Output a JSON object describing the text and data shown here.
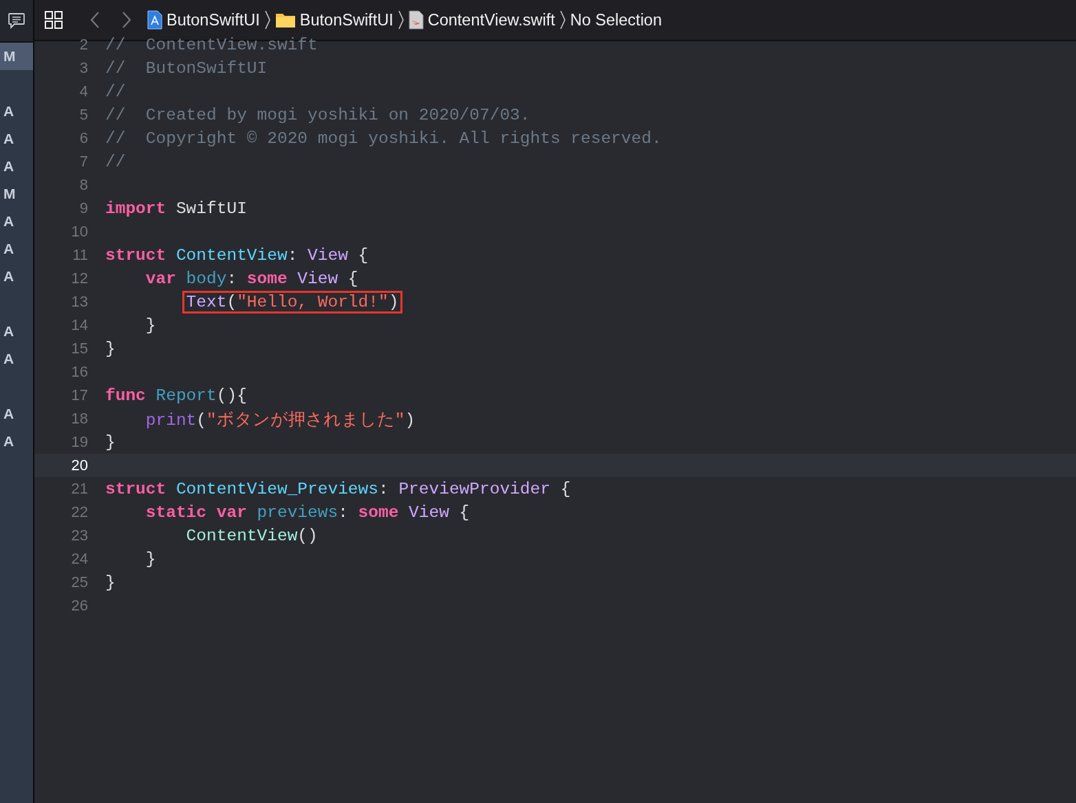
{
  "toolbar": {
    "breadcrumb": [
      {
        "kind": "project",
        "label": "ButonSwiftUI"
      },
      {
        "kind": "folder",
        "label": "ButonSwiftUI"
      },
      {
        "kind": "swift",
        "label": "ContentView.swift"
      },
      {
        "kind": "plain",
        "label": "No Selection"
      }
    ]
  },
  "sidebar": {
    "items": [
      {
        "kind": "status",
        "letter": "M",
        "selected": true
      },
      {
        "kind": "gap"
      },
      {
        "kind": "status",
        "letter": "A",
        "selected": false
      },
      {
        "kind": "status",
        "letter": "A",
        "selected": false
      },
      {
        "kind": "status",
        "letter": "A",
        "selected": false
      },
      {
        "kind": "status",
        "letter": "M",
        "selected": false
      },
      {
        "kind": "status",
        "letter": "A",
        "selected": false
      },
      {
        "kind": "status",
        "letter": "A",
        "selected": false
      },
      {
        "kind": "status",
        "letter": "A",
        "selected": false
      },
      {
        "kind": "gap"
      },
      {
        "kind": "status",
        "letter": "A",
        "selected": false
      },
      {
        "kind": "status",
        "letter": "A",
        "selected": false
      },
      {
        "kind": "gap"
      },
      {
        "kind": "status",
        "letter": "A",
        "selected": false
      },
      {
        "kind": "status",
        "letter": "A",
        "selected": false
      }
    ]
  },
  "editor": {
    "lines": [
      {
        "number": "2",
        "current": false,
        "tokens": [
          {
            "text": "//  ContentView.swift",
            "kind": "comment"
          }
        ]
      },
      {
        "number": "3",
        "current": false,
        "tokens": [
          {
            "text": "//  ButonSwiftUI",
            "kind": "comment"
          }
        ]
      },
      {
        "number": "4",
        "current": false,
        "tokens": [
          {
            "text": "//",
            "kind": "comment"
          }
        ]
      },
      {
        "number": "5",
        "current": false,
        "tokens": [
          {
            "text": "//  Created by mogi yoshiki on 2020/07/03.",
            "kind": "comment"
          }
        ]
      },
      {
        "number": "6",
        "current": false,
        "tokens": [
          {
            "text": "//  Copyright © 2020 mogi yoshiki. All rights reserved.",
            "kind": "comment"
          }
        ]
      },
      {
        "number": "7",
        "current": false,
        "tokens": [
          {
            "text": "//",
            "kind": "comment"
          }
        ]
      },
      {
        "number": "8",
        "current": false
      },
      {
        "number": "9",
        "current": false,
        "tokens": [
          {
            "text": "import",
            "kind": "keyword"
          },
          {
            "text": " SwiftUI",
            "kind": "plain"
          }
        ]
      },
      {
        "number": "10",
        "current": false
      },
      {
        "number": "11",
        "current": false,
        "tokens": [
          {
            "text": "struct",
            "kind": "keyword"
          },
          {
            "text": " ContentView",
            "kind": "decl"
          },
          {
            "text": ": ",
            "kind": "plain"
          },
          {
            "text": "View",
            "kind": "type"
          },
          {
            "text": " {",
            "kind": "plain"
          }
        ]
      },
      {
        "number": "12",
        "current": false,
        "tokens": [
          {
            "text": "    var",
            "kind": "keyword"
          },
          {
            "text": " body",
            "kind": "member"
          },
          {
            "text": ": ",
            "kind": "plain"
          },
          {
            "text": "some",
            "kind": "keyword"
          },
          {
            "text": " View",
            "kind": "type"
          },
          {
            "text": " {",
            "kind": "plain"
          }
        ]
      },
      {
        "number": "13",
        "current": false,
        "tokens": [
          {
            "kind": "callout",
            "nested": true,
            "tokens": [
              {
                "text": "Text",
                "kind": "type"
              },
              {
                "text": "(",
                "kind": "plain"
              },
              {
                "text": "\"Hello, World!\"",
                "kind": "string"
              },
              {
                "text": ")",
                "kind": "plain"
              }
            ]
          }
        ]
      },
      {
        "number": "14",
        "current": false,
        "tokens": [
          {
            "text": "    }",
            "kind": "plain"
          }
        ]
      },
      {
        "number": "15",
        "current": false,
        "tokens": [
          {
            "text": "}",
            "kind": "plain"
          }
        ]
      },
      {
        "number": "16",
        "current": false
      },
      {
        "number": "17",
        "current": false,
        "tokens": [
          {
            "text": "func",
            "kind": "keyword"
          },
          {
            "text": " Report",
            "kind": "member"
          },
          {
            "text": "(){",
            "kind": "plain"
          }
        ]
      },
      {
        "number": "18",
        "current": false,
        "tokens": [
          {
            "text": "    print",
            "kind": "library"
          },
          {
            "text": "(",
            "kind": "plain"
          },
          {
            "text": "\"ボタンが押されました\"",
            "kind": "string"
          },
          {
            "text": ")",
            "kind": "plain"
          }
        ]
      },
      {
        "number": "19",
        "current": false,
        "tokens": [
          {
            "text": "}",
            "kind": "plain"
          }
        ]
      },
      {
        "number": "20",
        "current": true
      },
      {
        "number": "21",
        "current": false,
        "tokens": [
          {
            "text": "struct",
            "kind": "keyword"
          },
          {
            "text": " ContentView_Previews",
            "kind": "decl"
          },
          {
            "text": ": ",
            "kind": "plain"
          },
          {
            "text": "PreviewProvider",
            "kind": "type"
          },
          {
            "text": " {",
            "kind": "plain"
          }
        ]
      },
      {
        "number": "22",
        "current": false,
        "tokens": [
          {
            "text": "    static",
            "kind": "keyword"
          },
          {
            "text": " var",
            "kind": "keyword"
          },
          {
            "text": " previews",
            "kind": "member"
          },
          {
            "text": ": ",
            "kind": "plain"
          },
          {
            "text": "some",
            "kind": "keyword"
          },
          {
            "text": " View",
            "kind": "type"
          },
          {
            "text": " {",
            "kind": "plain"
          }
        ]
      },
      {
        "number": "23",
        "current": false,
        "tokens": [
          {
            "text": "        ContentView",
            "kind": "project"
          },
          {
            "text": "()",
            "kind": "plain"
          }
        ]
      },
      {
        "number": "24",
        "current": false,
        "tokens": [
          {
            "text": "    }",
            "kind": "plain"
          }
        ]
      },
      {
        "number": "25",
        "current": false,
        "tokens": [
          {
            "text": "}",
            "kind": "plain"
          }
        ]
      },
      {
        "number": "26",
        "current": false
      }
    ]
  }
}
